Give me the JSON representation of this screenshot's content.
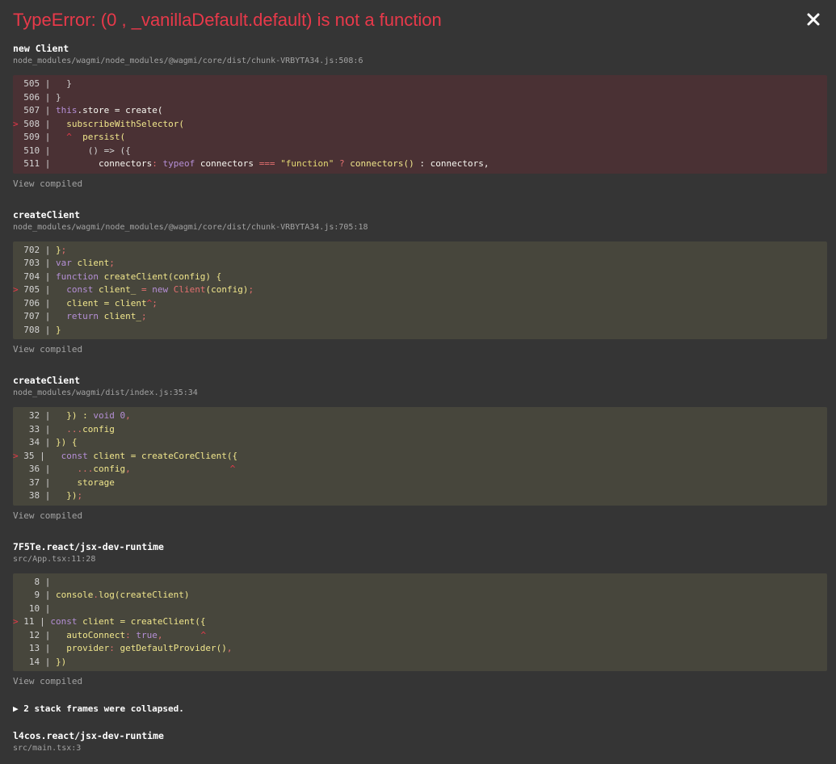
{
  "error": {
    "title": "TypeError: (0 , _vanillaDefault.default) is not a function",
    "close_icon": "close-icon",
    "close_glyph": "✕"
  },
  "frames": [
    {
      "name": "new Client",
      "path": "node_modules/wagmi/node_modules/@wagmi/core/dist/chunk-VRBYTA34.js:508:6",
      "highlight": true
    },
    {
      "name": "createClient",
      "path": "node_modules/wagmi/node_modules/@wagmi/core/dist/chunk-VRBYTA34.js:705:18",
      "highlight": false
    },
    {
      "name": "createClient",
      "path": "node_modules/wagmi/dist/index.js:35:34",
      "highlight": false
    },
    {
      "name": "7F5Te.react/jsx-dev-runtime",
      "path": "src/App.tsx:11:28",
      "highlight": false
    }
  ],
  "view_compiled_label": "View compiled",
  "collapsed_label": "▶ 2 stack frames were collapsed.",
  "last_frame": {
    "name": "l4cos.react/jsx-dev-runtime",
    "path": "src/main.tsx:3"
  },
  "code": {
    "f0": {
      "l505": "  505 |   }",
      "l506": "  506 | }",
      "l507_pre": "  507 | ",
      "l507_kw": "this",
      "l507_rest": ".store = create(",
      "l508_mark": "> ",
      "l508_ln": "508 | ",
      "l508_code": "  subscribeWithSelector(",
      "l509_ln": "  509 | ",
      "l509_caret": "  ^",
      "l509_code": "  persist(",
      "l510": "  510 |       () => ({",
      "l511_ln": "  511 | ",
      "l511_a": "        connectors",
      "l511_b": ": ",
      "l511_c": "typeof",
      "l511_d": " connectors ",
      "l511_e": "===",
      "l511_f": " ",
      "l511_g": "\"function\"",
      "l511_h": " ? ",
      "l511_i": "connectors()",
      "l511_j": " : connectors,"
    },
    "f1": {
      "l702_ln": "  702 | ",
      "l702_code": "}",
      "l702_pun": ";",
      "l703_ln": "  703 | ",
      "l703_kw": "var",
      "l703_code": " client",
      "l703_pun": ";",
      "l704_ln": "  704 | ",
      "l704_kw": "function",
      "l704_code": " createClient(config) {",
      "l705_mark": "> ",
      "l705_ln": "705 | ",
      "l705_kw1": "  const",
      "l705_code1": " client_ ",
      "l705_eq": "=",
      "l705_kw2": " new",
      "l705_ctor": " Client",
      "l705_code2": "(config)",
      "l705_pun": ";",
      "l706_ln": "  706 | ",
      "l706_code": "  client = client",
      "l706_caret": "^",
      "l706_pun": ";",
      "l707_ln": "  707 | ",
      "l707_kw": "  return",
      "l707_code": " client_",
      "l707_pun": ";",
      "l708_ln": "  708 | ",
      "l708_code": "}"
    },
    "f2": {
      "l32_ln": "   32 | ",
      "l32_code": "  }) : ",
      "l32_kw": "void",
      "l32_num": " 0",
      "l32_pun": ",",
      "l33_ln": "   33 | ",
      "l33_pun": "  ...",
      "l33_code": "config",
      "l34_ln": "   34 | ",
      "l34_code": "}) {",
      "l35_mark": "> ",
      "l35_ln": "35 | ",
      "l35_kw": "  const",
      "l35_code": " client = createCoreClient({",
      "l36_ln": "   36 | ",
      "l36_pun1": "    ...",
      "l36_code": "config",
      "l36_pun2": ",",
      "l36_caret": "^",
      "l37_ln": "   37 | ",
      "l37_code": "    storage",
      "l38_ln": "   38 | ",
      "l38_code": "  })",
      "l38_pun": ";"
    },
    "f3": {
      "l8": "    8 | ",
      "l9_ln": "    9 | ",
      "l9_a": "console",
      "l9_b": ".",
      "l9_c": "log(createClient)",
      "l10": "   10 | ",
      "l11_mark": "> ",
      "l11_ln": "11 | ",
      "l11_kw": "const",
      "l11_code": " client = createClient({",
      "l12_ln": "   12 | ",
      "l12_code": "  autoConnect",
      "l12_pun": ": ",
      "l12_kw": "true",
      "l12_pun2": ",",
      "l12_caret": "^",
      "l13_ln": "   13 | ",
      "l13_code": "  provider",
      "l13_pun": ": ",
      "l13_code2": "getDefaultProvider()",
      "l13_pun2": ",",
      "l14_ln": "   14 | ",
      "l14_code": "})"
    }
  }
}
